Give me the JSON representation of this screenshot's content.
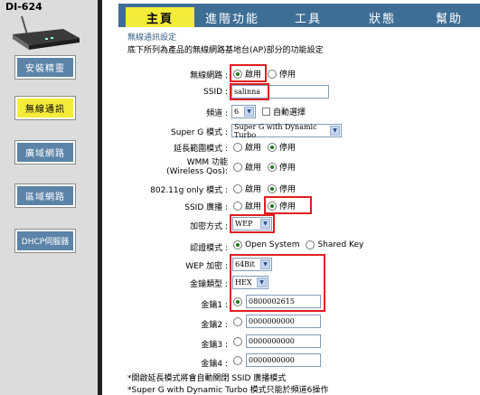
{
  "sidebar": {
    "model": "DI-624",
    "device_icon": "router-device-icon",
    "items": [
      {
        "label": "安裝精靈",
        "active": false
      },
      {
        "label": "無線通訊",
        "active": true
      },
      {
        "label": "廣域網路",
        "active": false
      },
      {
        "label": "區域網路",
        "active": false
      },
      {
        "label": "DHCP伺服器",
        "active": false
      }
    ]
  },
  "tabs": [
    {
      "label": "主頁",
      "active": true
    },
    {
      "label": "進階功能",
      "active": false
    },
    {
      "label": "工具",
      "active": false
    },
    {
      "label": "狀態",
      "active": false
    },
    {
      "label": "幫助",
      "active": false
    }
  ],
  "section": {
    "title": "無線通訊設定",
    "description": "底下所列為產品的無線網路基地台(AP)部分的功能設定"
  },
  "form": {
    "wireless": {
      "label": "無線網路 :",
      "opt_on": "啟用",
      "opt_off": "停用",
      "selected": "on"
    },
    "ssid": {
      "label": "SSID :",
      "value": "salinna"
    },
    "channel": {
      "label": "頻道 :",
      "value": "6",
      "auto_label": "自動選擇"
    },
    "superg": {
      "label": "Super G 模式 :",
      "value": "Super G with Dynamic Turbo"
    },
    "extended_range": {
      "label": "延長範圍模式 :",
      "opt_on": "啟用",
      "opt_off": "停用",
      "selected": "off"
    },
    "wmm": {
      "label_line1": "WMM 功能",
      "label_line2": "(Wireless Qos):",
      "opt_on": "啟用",
      "opt_off": "停用",
      "selected": "off"
    },
    "g_only": {
      "label": "802.11g only 模式 :",
      "opt_on": "啟用",
      "opt_off": "停用",
      "selected": "off"
    },
    "ssid_broadcast": {
      "label": "SSID 廣播 :",
      "opt_on": "啟用",
      "opt_off": "停用",
      "selected": "off"
    },
    "encryption": {
      "label": "加密方式 :",
      "value": "WEP"
    },
    "auth": {
      "label": "認證模式 :",
      "opt_open": "Open System",
      "opt_shared": "Shared Key",
      "selected": "open"
    },
    "wep_bits": {
      "label": "WEP 加密 :",
      "value": "64Bit"
    },
    "key_type": {
      "label": "金鑰類型 :",
      "value": "HEX"
    },
    "keys": [
      {
        "label": "金鑰1 :",
        "value": "0800002615",
        "selected": true
      },
      {
        "label": "金鑰2 :",
        "value": "0000000000",
        "selected": false
      },
      {
        "label": "金鑰3 :",
        "value": "0000000000",
        "selected": false
      },
      {
        "label": "金鑰4 :",
        "value": "0000000000",
        "selected": false
      }
    ]
  },
  "notes": [
    "*開啟延長模式將會自動關閉 SSID 廣播模式",
    "*Super G with Dynamic Turbo 模式只能於頻道6操作"
  ],
  "colors": {
    "tab_bar": "#3e6e95",
    "accent_yellow": "#f4ec3a",
    "nav_blue": "#5b84a8",
    "highlight_red": "#e02020"
  }
}
